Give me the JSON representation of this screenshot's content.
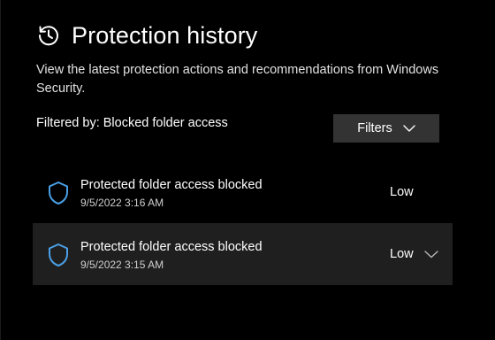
{
  "header": {
    "title": "Protection history",
    "icon": "history-icon"
  },
  "description": "View the latest protection actions and recommendations from Windows Security.",
  "filter": {
    "label": "Filtered by: Blocked folder access",
    "button_label": "Filters"
  },
  "items": [
    {
      "title": "Protected folder access blocked",
      "date": "9/5/2022 3:16 AM",
      "severity": "Low",
      "icon": "shield-icon",
      "selected": false
    },
    {
      "title": "Protected folder access blocked",
      "date": "9/5/2022 3:15 AM",
      "severity": "Low",
      "icon": "shield-icon",
      "selected": true
    }
  ],
  "colors": {
    "background": "#000000",
    "accent": "#4aa0e6",
    "button": "#333333",
    "selected_row": "#1f1f1f"
  }
}
